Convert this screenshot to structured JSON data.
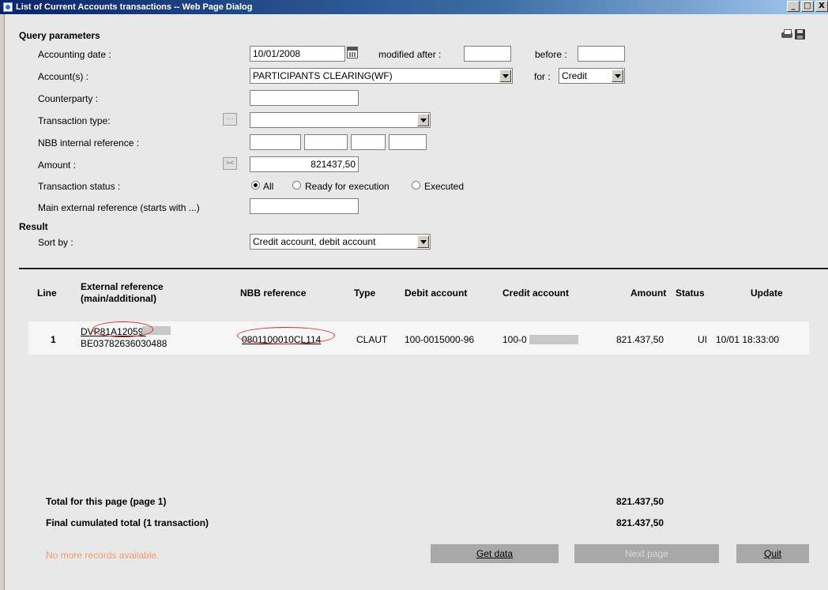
{
  "window": {
    "title": "List of Current Accounts transactions -- Web Page Dialog",
    "minimize": "_",
    "maximize": "□",
    "close": "X"
  },
  "query": {
    "heading": "Query parameters",
    "accounting_date_label": "Accounting date :",
    "accounting_date_value": "10/01/2008",
    "modified_after_label": "modified after :",
    "modified_after_value": "",
    "before_label": "before :",
    "before_value": "",
    "accounts_label": "Account(s) :",
    "accounts_value": "PARTICIPANTS CLEARING(WF)",
    "for_label": "for :",
    "for_value": "Credit",
    "counterparty_label": "Counterparty :",
    "counterparty_value": "",
    "transaction_type_label": "Transaction type:",
    "transaction_type_value": "",
    "transaction_type_btn": "···",
    "nbb_internal_label": "NBB internal reference :",
    "nbb_internal_values": [
      "",
      "",
      "",
      ""
    ],
    "amount_label": "Amount :",
    "amount_btn": "><",
    "amount_value": "821437,50",
    "status_label": "Transaction status :",
    "status_options": [
      "All",
      "Ready for execution",
      "Executed"
    ],
    "status_selected": "All",
    "main_ext_label": "Main external reference (starts with ...)",
    "main_ext_value": ""
  },
  "result": {
    "heading": "Result",
    "sort_label": "Sort by :",
    "sort_value": "Credit account, debit account"
  },
  "table": {
    "headers": {
      "line": "Line",
      "ext_ref_1": "External reference",
      "ext_ref_2": "(main/additional)",
      "nbb_ref": "NBB reference",
      "type": "Type",
      "debit": "Debit account",
      "credit": "Credit account",
      "amount": "Amount",
      "status": "Status",
      "update": "Update"
    },
    "rows": [
      {
        "line": "1",
        "ext_main": "DVP81A12059/",
        "ext_additional": "BE03782636030488",
        "nbb_ref": "0801100010CL114",
        "type": "CLAUT",
        "debit": "100-0015000-96",
        "credit": "100-0",
        "amount": "821.437,50",
        "status": "UI",
        "update": "10/01 18:33:00"
      }
    ]
  },
  "totals": {
    "page_label": "Total for this page (page 1)",
    "page_value": "821.437,50",
    "final_label": "Final cumulated total (1 transaction)",
    "final_value": "821.437,50"
  },
  "footer": {
    "no_more": "No more records available.",
    "get_data": "Get data",
    "next_page": "Next page",
    "quit": "Quit"
  },
  "colors": {
    "annotation": "#d8282b",
    "no_more_text": "#f09a6a"
  }
}
